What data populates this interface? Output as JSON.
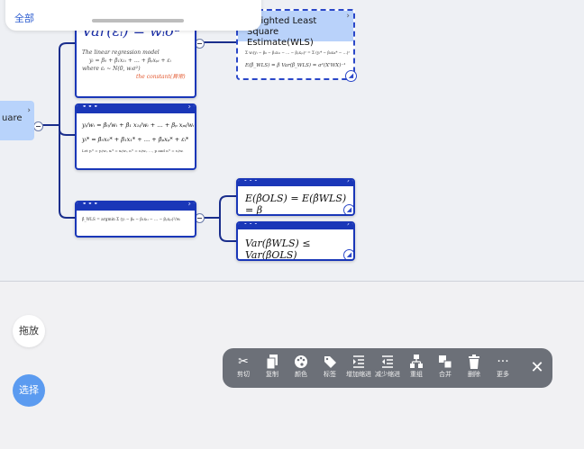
{
  "top_bar": {
    "all_label": "全部"
  },
  "root_node": {
    "label": "uare"
  },
  "card1": {
    "big_formula": "Var(εᵢ) = wᵢσ²",
    "notes": [
      "The linear regression model",
      "yᵢ = β₀ + β₁x₁ᵢ + … + βₚxₚᵢ + εᵢ",
      "where εᵢ ~ N(0, wᵢσ²)",
      "the constant(异常)"
    ]
  },
  "card2": {
    "line1": "yᵢ/wᵢ = β₀/wᵢ + β₁ x₁ᵢ/wᵢ + … + βₚ xₚᵢ/wᵢ + εᵢ/wᵢ",
    "line2": "yᵢ* = β₀x₀* + β₁x₁* + … + βₚxₚ* + εᵢ*",
    "line3": "Let yᵢ* = yᵢ/wᵢ, xᵢ* = xᵢ/wᵢ, εᵢ* = εᵢ/wᵢ, …, p and εᵢ* = εᵢ/wᵢ"
  },
  "card3": {
    "formula": "β̂_WLS = argmin Σ (yᵢ − β₀ − β₁x₁ᵢ − … − βₚxₚᵢ)²/wᵢ"
  },
  "wls_node": {
    "title": "Weighted Least Square Estimate(WLS)",
    "line1": "Σ wᵢ(yᵢ − β₀ − β₁x₁ᵢ − … − βₚxₚᵢ)² = Σ (yᵢ* − β₀x₀ᵢ* − …)²",
    "line2": "E(β̂_WLS) = β     Var(β̂_WLS) = σ²(X'WX)⁻¹"
  },
  "result1": {
    "equation": "E(β̂OLS) = E(β̂WLS) = β"
  },
  "result2": {
    "equation": "Var(β̂WLS) ≤ Var(β̂OLS)"
  },
  "side_buttons": {
    "drag": "拖放",
    "select": "选择"
  },
  "toolbar": {
    "items": [
      {
        "label": "剪切",
        "icon": "scissors-icon"
      },
      {
        "label": "复制",
        "icon": "copy-icon"
      },
      {
        "label": "颜色",
        "icon": "palette-icon"
      },
      {
        "label": "标签",
        "icon": "tag-icon"
      },
      {
        "label": "增加缩进",
        "icon": "indent-increase-icon"
      },
      {
        "label": "减少缩进",
        "icon": "indent-decrease-icon"
      },
      {
        "label": "重组",
        "icon": "reorganize-icon"
      },
      {
        "label": "合并",
        "icon": "merge-icon"
      },
      {
        "label": "删除",
        "icon": "trash-icon"
      },
      {
        "label": "更多",
        "icon": "more-icon"
      }
    ],
    "close_icon": "close-icon"
  }
}
